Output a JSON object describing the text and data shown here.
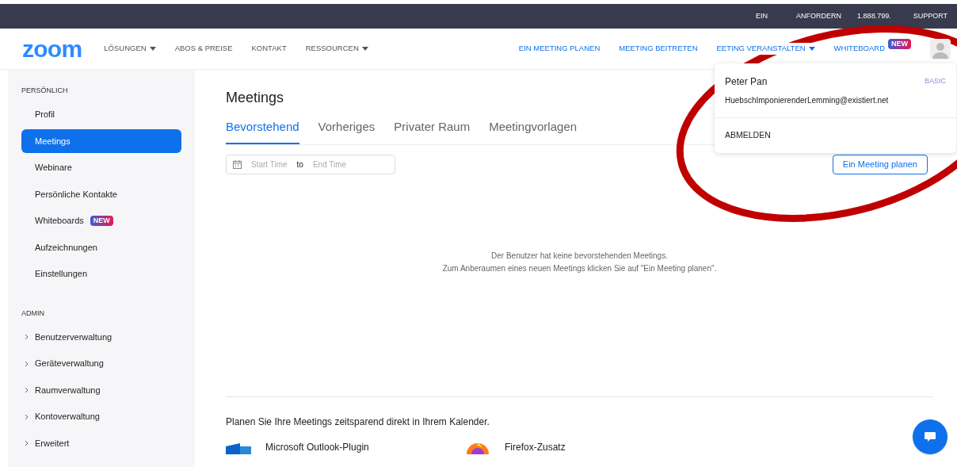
{
  "top_bar": {
    "left_parts": [
      "EIN",
      "ANFORDERN"
    ],
    "phone_parts": [
      "1.888.799.",
      "SUPPORT"
    ]
  },
  "nav": {
    "logo": "zoom",
    "left_items": [
      {
        "label": "LÖSUNGEN",
        "dropdown": true
      },
      {
        "label": "ABOS & PREISE",
        "dropdown": false
      },
      {
        "label": "KONTAKT",
        "dropdown": false
      },
      {
        "label": "RESSOURCEN",
        "dropdown": true
      }
    ],
    "right_items": [
      {
        "label": "EIN MEETING PLANEN",
        "dropdown": false
      },
      {
        "label": "MEETING BEITRETEN",
        "dropdown": false
      },
      {
        "label": "EETING VERANSTALTEN",
        "dropdown": true
      },
      {
        "label": "WHITEBOARD",
        "dropdown": false,
        "badge": "NEW"
      }
    ]
  },
  "user_menu": {
    "name": "Peter Pan",
    "plan": "BASIC",
    "email": "HuebschImponierenderLemming@existiert.net",
    "sign_out": "ABMELDEN"
  },
  "sidebar": {
    "sections": [
      {
        "title": "PERSÖNLICH",
        "items": [
          {
            "label": "Profil",
            "selected": false,
            "expandable": false
          },
          {
            "label": "Meetings",
            "selected": true,
            "expandable": false
          },
          {
            "label": "Webinare",
            "selected": false,
            "expandable": false
          },
          {
            "label": "Persönliche Kontakte",
            "selected": false,
            "expandable": false
          },
          {
            "label": "Whiteboards",
            "selected": false,
            "expandable": false,
            "badge": "NEW"
          },
          {
            "label": "Aufzeichnungen",
            "selected": false,
            "expandable": false
          },
          {
            "label": "Einstellungen",
            "selected": false,
            "expandable": false
          }
        ]
      },
      {
        "title": "ADMIN",
        "items": [
          {
            "label": "Benutzerverwaltung",
            "selected": false,
            "expandable": true
          },
          {
            "label": "Geräteverwaltung",
            "selected": false,
            "expandable": true
          },
          {
            "label": "Raumverwaltung",
            "selected": false,
            "expandable": true
          },
          {
            "label": "Kontoverwaltung",
            "selected": false,
            "expandable": true
          },
          {
            "label": "Erweitert",
            "selected": false,
            "expandable": true
          }
        ]
      }
    ]
  },
  "main": {
    "title": "Meetings",
    "tabs": [
      {
        "label": "Bevorstehend",
        "selected": true
      },
      {
        "label": "Vorheriges",
        "selected": false
      },
      {
        "label": "Privater Raum",
        "selected": false
      },
      {
        "label": "Meetingvorlagen",
        "selected": false
      }
    ],
    "date_range": {
      "start_placeholder": "Start Time",
      "separator": "to",
      "end_placeholder": "End Time"
    },
    "schedule_button": "Ein Meeting planen",
    "empty_message": [
      "Der Benutzer hat keine bevorstehenden Meetings.",
      "Zum Anberaumen eines neuen Meetings klicken Sie auf \"Ein Meeting planen\"."
    ],
    "calendar_heading": "Planen Sie Ihre Meetings zeitsparend direkt in Ihrem Kalender.",
    "plugins": [
      {
        "kind": "outlook",
        "label": "Microsoft Outlook-Plugin"
      },
      {
        "kind": "firefox",
        "label": "Firefox-Zusatz"
      }
    ]
  }
}
